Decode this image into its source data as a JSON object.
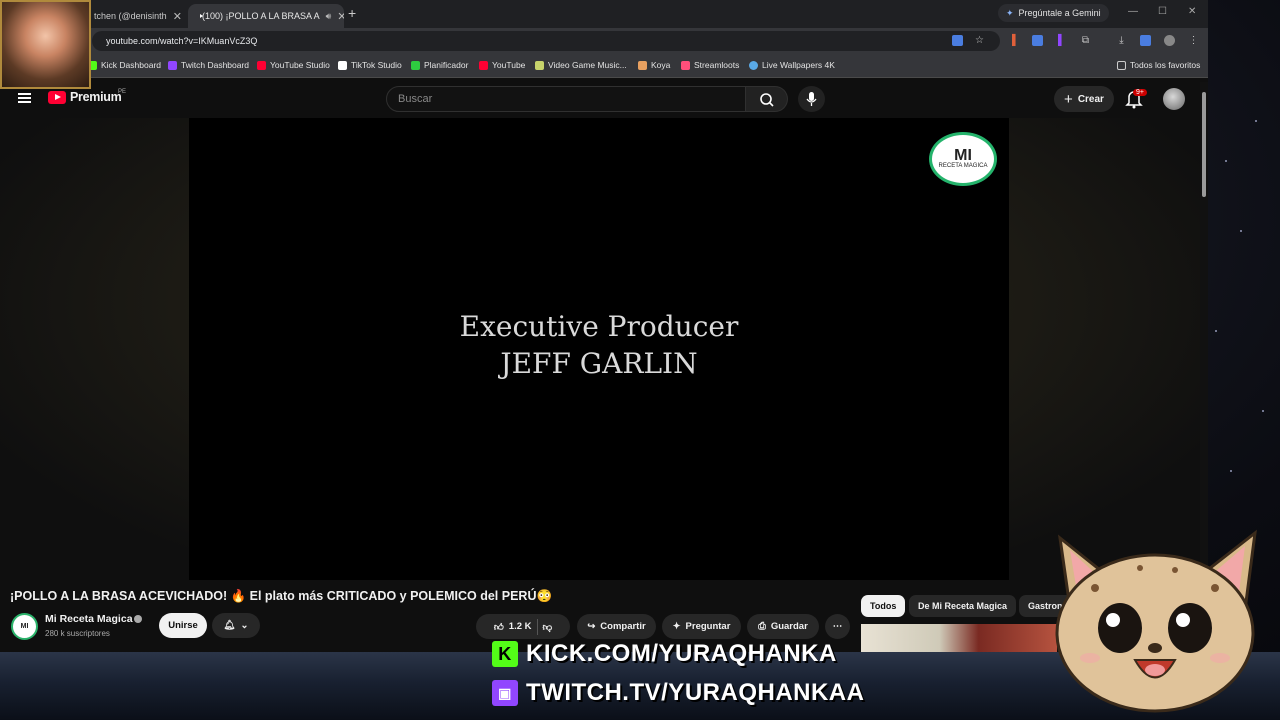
{
  "browser": {
    "tabs": [
      {
        "label": "tchen (@denisinth"
      },
      {
        "label": "(100) ¡POLLO A LA BRASA A"
      }
    ],
    "gemini_label": "Pregúntale a Gemini",
    "url": "youtube.com/watch?v=IKMuanVcZ3Q",
    "bookmarks": [
      {
        "label": "Kick Dashboard",
        "color": "#53fc18"
      },
      {
        "label": "Twitch Dashboard",
        "color": "#9146ff"
      },
      {
        "label": "YouTube Studio",
        "color": "#ff0033"
      },
      {
        "label": "TikTok Studio",
        "color": "#ffffff"
      },
      {
        "label": "Planificador",
        "color": "#2ecc40"
      },
      {
        "label": "YouTube",
        "color": "#ff0033"
      },
      {
        "label": "Video Game Music...",
        "color": "#c7d36b"
      },
      {
        "label": "Koya",
        "color": "#e8a060"
      },
      {
        "label": "Streamloots",
        "color": "#ff4f7b"
      },
      {
        "label": "Live Wallpapers 4K",
        "color": "#5aa9e6"
      }
    ],
    "all_bookmarks_label": "Todos los favoritos"
  },
  "youtube": {
    "logo_text": "Premium",
    "region": "PE",
    "search_placeholder": "Buscar",
    "create_label": "Crear",
    "notification_badge": "9+",
    "video": {
      "credit_line1": "Executive Producer",
      "credit_line2": "JEFF GARLIN",
      "watermark_top": "MI",
      "watermark_bottom": "RECETA MAGICA"
    },
    "title": "¡POLLO A LA BRASA ACEVICHADO! 🔥 El plato más CRITICADO y POLEMICO del PERÚ😳",
    "channel": {
      "avatar_text": "MI",
      "name": "Mi Receta Magica",
      "subscribers": "280 k suscriptores",
      "join_label": "Unirse"
    },
    "actions": {
      "likes": "1.2 K",
      "share": "Compartir",
      "ask": "Preguntar",
      "save": "Guardar"
    },
    "chips": [
      "Todos",
      "De Mi Receta Magica",
      "Gastrono"
    ]
  },
  "overlay": {
    "kick": "KICK.COM/YURAQHANKA",
    "twitch": "TWITCH.TV/YURAQHANKAA"
  }
}
